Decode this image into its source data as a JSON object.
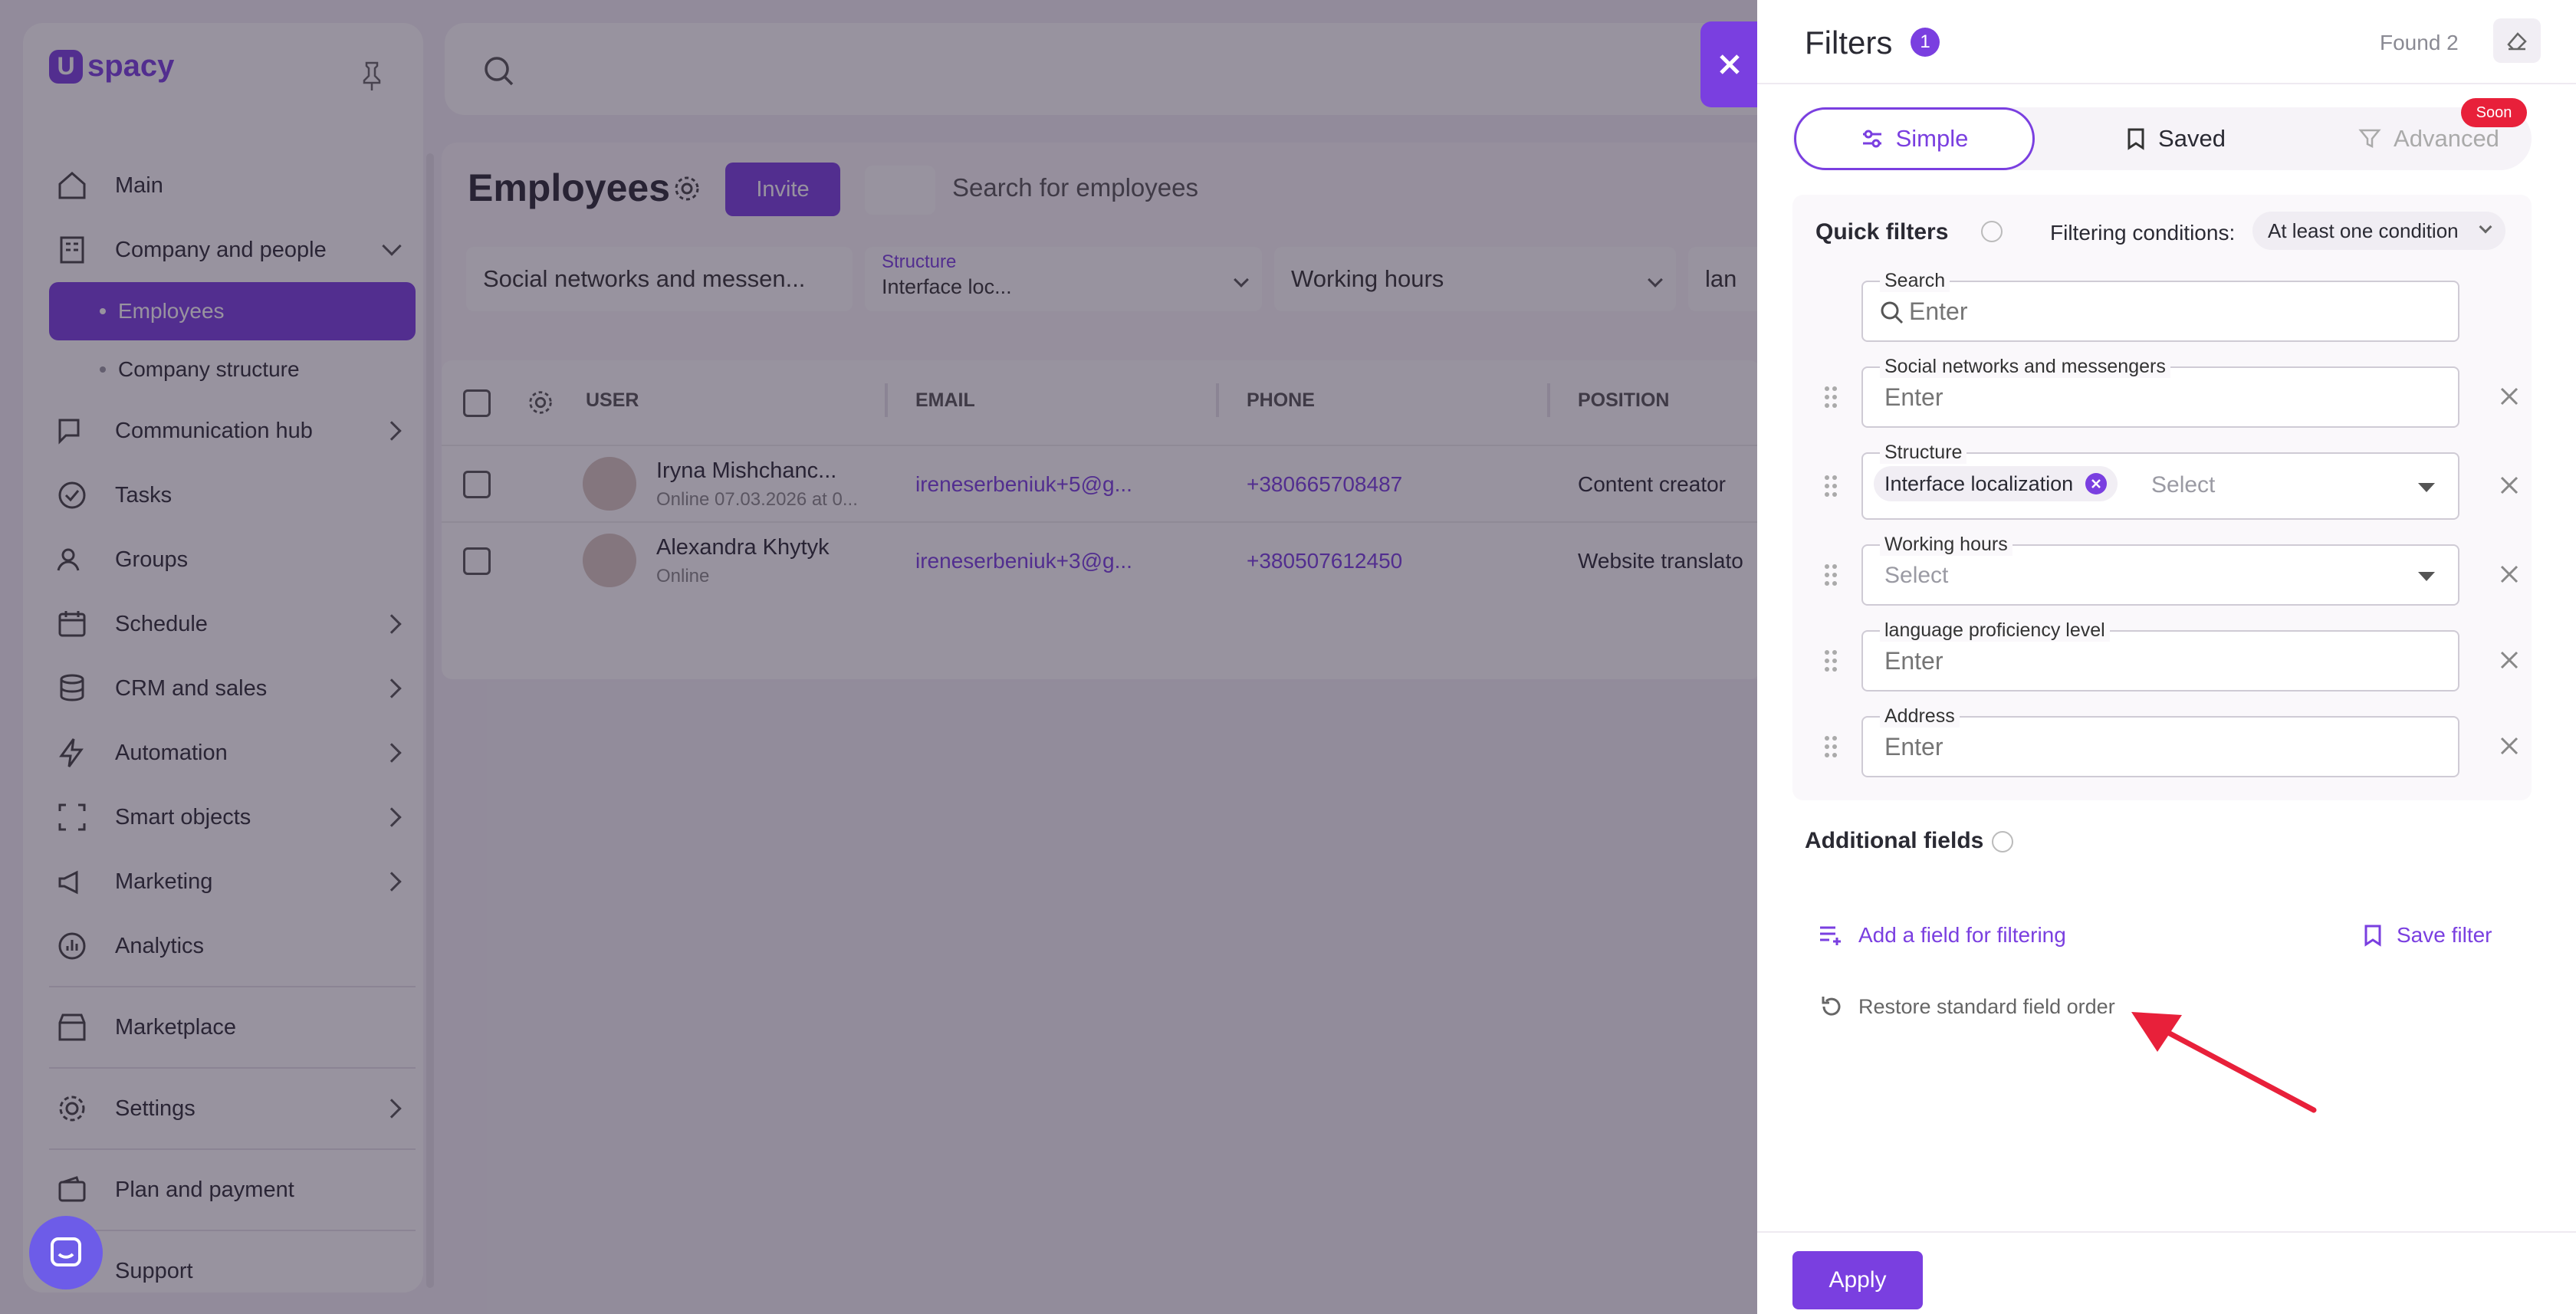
{
  "app": {
    "logo": "spacy",
    "logo_mark": "U"
  },
  "sidebar": {
    "items": [
      {
        "label": "Main",
        "icon": "home-icon"
      },
      {
        "label": "Company and people",
        "icon": "building-icon",
        "expanded": true
      },
      {
        "label": "Employees",
        "sub": true,
        "active": true
      },
      {
        "label": "Company structure",
        "sub": true
      },
      {
        "label": "Communication hub",
        "icon": "chat-icon"
      },
      {
        "label": "Tasks",
        "icon": "check-circle-icon"
      },
      {
        "label": "Groups",
        "icon": "users-icon"
      },
      {
        "label": "Schedule",
        "icon": "calendar-icon"
      },
      {
        "label": "CRM and sales",
        "icon": "database-icon"
      },
      {
        "label": "Automation",
        "icon": "bolt-icon"
      },
      {
        "label": "Smart objects",
        "icon": "scan-icon"
      },
      {
        "label": "Marketing",
        "icon": "megaphone-icon"
      },
      {
        "label": "Analytics",
        "icon": "chart-icon"
      },
      {
        "label": "Marketplace",
        "icon": "store-icon"
      },
      {
        "label": "Settings",
        "icon": "gear-icon"
      },
      {
        "label": "Plan and payment",
        "icon": "wallet-icon"
      },
      {
        "label": "Support",
        "icon": "support-icon"
      }
    ]
  },
  "employees": {
    "title": "Employees",
    "invite_label": "Invite",
    "search_placeholder": "Search for employees",
    "chips": {
      "social": "Social networks and messen...",
      "structure_label": "Structure",
      "structure_value": "Interface loc...",
      "working_hours": "Working hours",
      "lang_partial": "lan"
    },
    "columns": [
      "USER",
      "EMAIL",
      "PHONE",
      "POSITION"
    ],
    "rows": [
      {
        "name": "Iryna Mishchanc...",
        "status": "Online 07.03.2026 at 0...",
        "email": "ireneserbeniuk+5@g...",
        "phone": "+380665708487",
        "position": "Content creator"
      },
      {
        "name": "Alexandra Khytyk",
        "status": "Online",
        "email": "ireneserbeniuk+3@g...",
        "phone": "+380507612450",
        "position": "Website translato"
      }
    ]
  },
  "filters": {
    "title": "Filters",
    "badge": "1",
    "found": "Found 2",
    "tabs": {
      "simple": "Simple",
      "saved": "Saved",
      "advanced": "Advanced",
      "soon": "Soon"
    },
    "quick_title": "Quick filters",
    "conditions_label": "Filtering conditions:",
    "conditions_value": "At least one condition",
    "fields": {
      "search_label": "Search",
      "search_placeholder": "Enter",
      "social_label": "Social networks and messengers",
      "social_placeholder": "Enter",
      "structure_label": "Structure",
      "structure_tag": "Interface localization",
      "structure_placeholder": "Select",
      "hours_label": "Working hours",
      "hours_placeholder": "Select",
      "lang_label": "language proficiency level",
      "lang_placeholder": "Enter",
      "address_label": "Address",
      "address_placeholder": "Enter"
    },
    "additional_title": "Additional fields",
    "add_field": "Add a field for filtering",
    "save_filter": "Save filter",
    "restore": "Restore standard field order",
    "apply": "Apply"
  },
  "colors": {
    "accent": "#7a3fe0",
    "soon_badge": "#e8203a",
    "annotation_arrow": "#e8203a"
  }
}
